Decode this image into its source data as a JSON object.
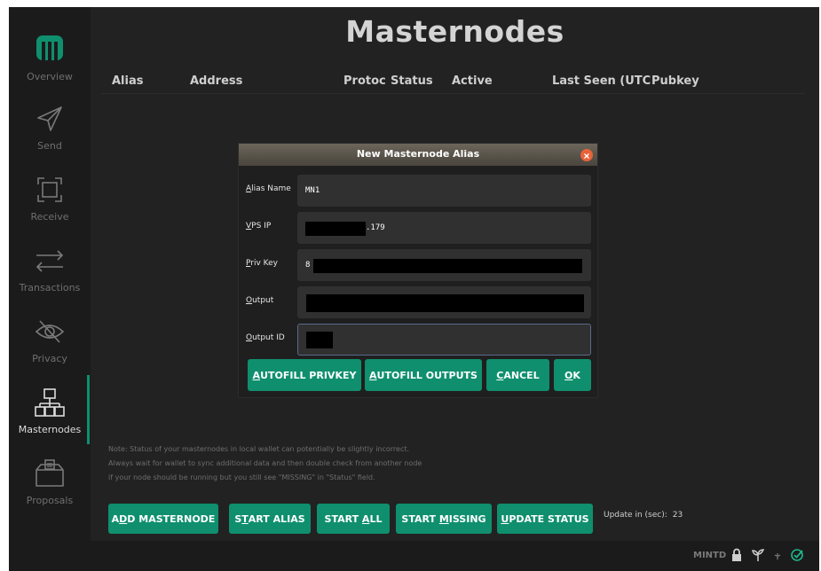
{
  "sidebar": {
    "items": [
      {
        "label": "Overview",
        "icon": "logo-icon"
      },
      {
        "label": "Send",
        "icon": "send-icon"
      },
      {
        "label": "Receive",
        "icon": "receive-icon"
      },
      {
        "label": "Transactions",
        "icon": "transactions-icon"
      },
      {
        "label": "Privacy",
        "icon": "privacy-eye-icon"
      },
      {
        "label": "Masternodes",
        "icon": "masternodes-icon"
      },
      {
        "label": "Proposals",
        "icon": "proposals-icon"
      }
    ],
    "active_index": 5
  },
  "page": {
    "title": "Masternodes",
    "columns": [
      "Alias",
      "Address",
      "Protoc",
      "Status",
      "Active",
      "Last Seen (UTC",
      "Pubkey"
    ],
    "notes": [
      "Note: Status of your masternodes in local wallet can potentially be slightly incorrect.",
      "Always wait for wallet to sync additional data and then double check from another node",
      "if your node should be running but you still see \"MISSING\" in \"Status\" field."
    ],
    "buttons": {
      "add": {
        "before": "A",
        "underline": "D",
        "after": "D MASTERNODE"
      },
      "start_alias": {
        "before": "S",
        "underline": "T",
        "after": "ART ALIAS"
      },
      "start_all": {
        "before": "START ",
        "underline": "A",
        "after": "LL"
      },
      "start_missing": {
        "before": "START ",
        "underline": "M",
        "after": "ISSING"
      },
      "update_status": {
        "before": "",
        "underline": "U",
        "after": "PDATE STATUS"
      }
    },
    "update_label": "Update in (sec):",
    "update_value": "23"
  },
  "statusbar": {
    "unit": "MINTD",
    "icons": [
      "lock-icon",
      "staking-icon",
      "tor-icon",
      "synced-check-icon"
    ]
  },
  "dialog": {
    "title": "New Masternode Alias",
    "fields": {
      "alias": {
        "label_u": "A",
        "label_rest": "lias Name",
        "value": "MN1"
      },
      "vps_ip": {
        "label_u": "V",
        "label_rest": "PS IP",
        "value": ".179"
      },
      "priv_key": {
        "label_u": "P",
        "label_rest": "riv Key",
        "value": "8"
      },
      "output": {
        "label_u": "O",
        "label_rest": "utput",
        "value": ""
      },
      "output_id": {
        "label_u": "O",
        "label_rest": "utput ID",
        "value": ""
      }
    },
    "buttons": {
      "autofill_privkey": {
        "before": "",
        "underline": "A",
        "after": "UTOFILL PRIVKEY"
      },
      "autofill_outputs": {
        "before": "",
        "underline": "A",
        "after": "UTOFILL OUTPUTS"
      },
      "cancel": {
        "before": "",
        "underline": "C",
        "after": "ANCEL"
      },
      "ok": {
        "before": "",
        "underline": "O",
        "after": "K"
      }
    }
  },
  "colors": {
    "accent": "#0f8f6e",
    "background": "#222222",
    "sidebar": "#1b1b1b",
    "close_button": "#e8623a"
  }
}
